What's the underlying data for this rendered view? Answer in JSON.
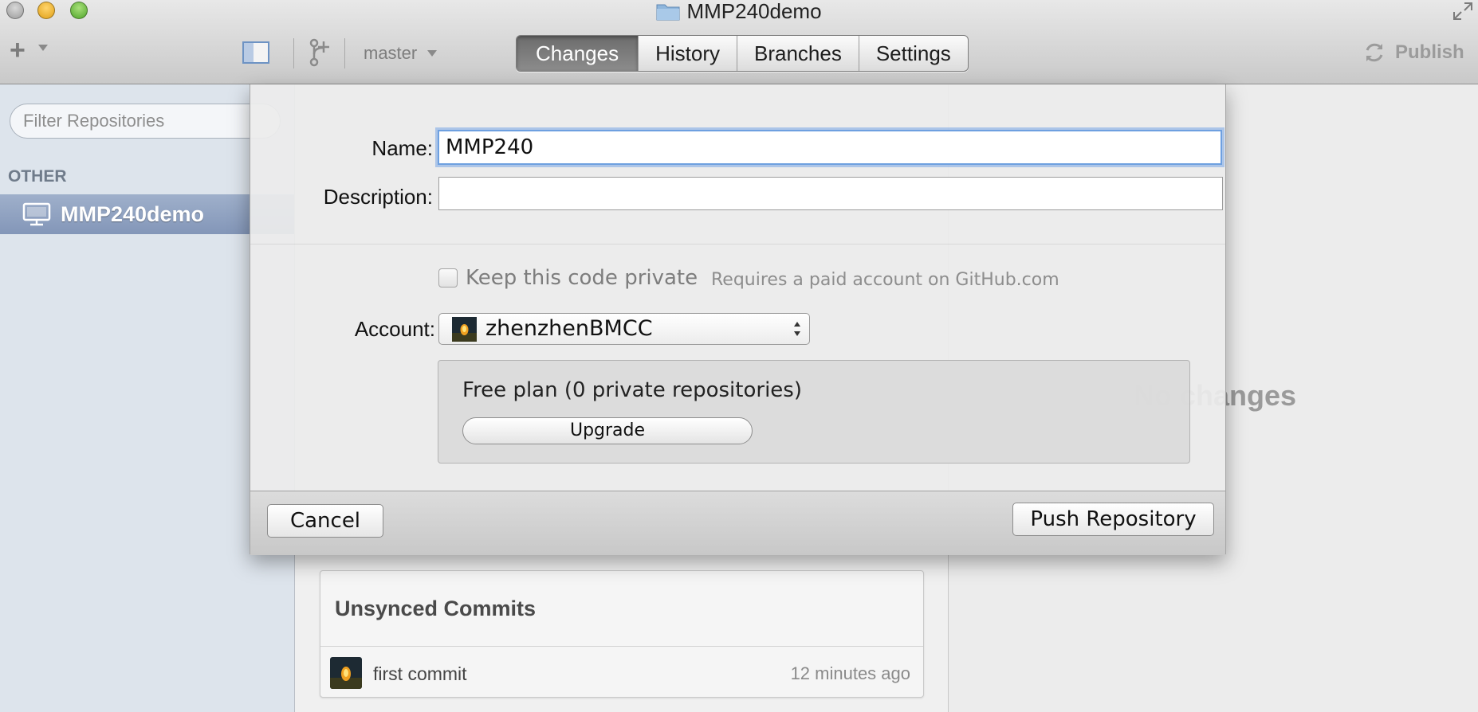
{
  "window": {
    "title": "MMP240demo"
  },
  "toolbar": {
    "branch": "master",
    "tabs": [
      {
        "label": "Changes",
        "active": true
      },
      {
        "label": "History",
        "active": false
      },
      {
        "label": "Branches",
        "active": false
      },
      {
        "label": "Settings",
        "active": false
      }
    ],
    "publish_label": "Publish"
  },
  "sidebar": {
    "filter_placeholder": "Filter Repositories",
    "section_header": "OTHER",
    "items": [
      {
        "label": "MMP240demo",
        "selected": true
      }
    ]
  },
  "main": {
    "empty_state": "No changes",
    "unsynced": {
      "title": "Unsynced Commits",
      "commits": [
        {
          "message": "first commit",
          "time": "12 minutes ago"
        }
      ]
    }
  },
  "dialog": {
    "name_label": "Name:",
    "name_value": "MMP240",
    "description_label": "Description:",
    "description_value": "",
    "private_label": "Keep this code private",
    "private_checked": false,
    "private_hint": "Requires a paid account on GitHub.com",
    "account_label": "Account:",
    "account_value": "zhenzhenBMCC",
    "plan_text": "Free plan (0 private repositories)",
    "upgrade_label": "Upgrade",
    "cancel_label": "Cancel",
    "push_label": "Push Repository"
  },
  "colors": {
    "focus_ring": "#6ea0e0",
    "sidebar_bg": "#dde4ec",
    "sidebar_selection": "#8c9dbd",
    "active_tab": "#7a7a7a"
  },
  "icons": [
    "folder-icon",
    "plus-icon",
    "sidebar-toggle-icon",
    "branch-icon",
    "sync-icon",
    "monitor-icon",
    "fullscreen-icon",
    "popup-arrows-icon"
  ]
}
